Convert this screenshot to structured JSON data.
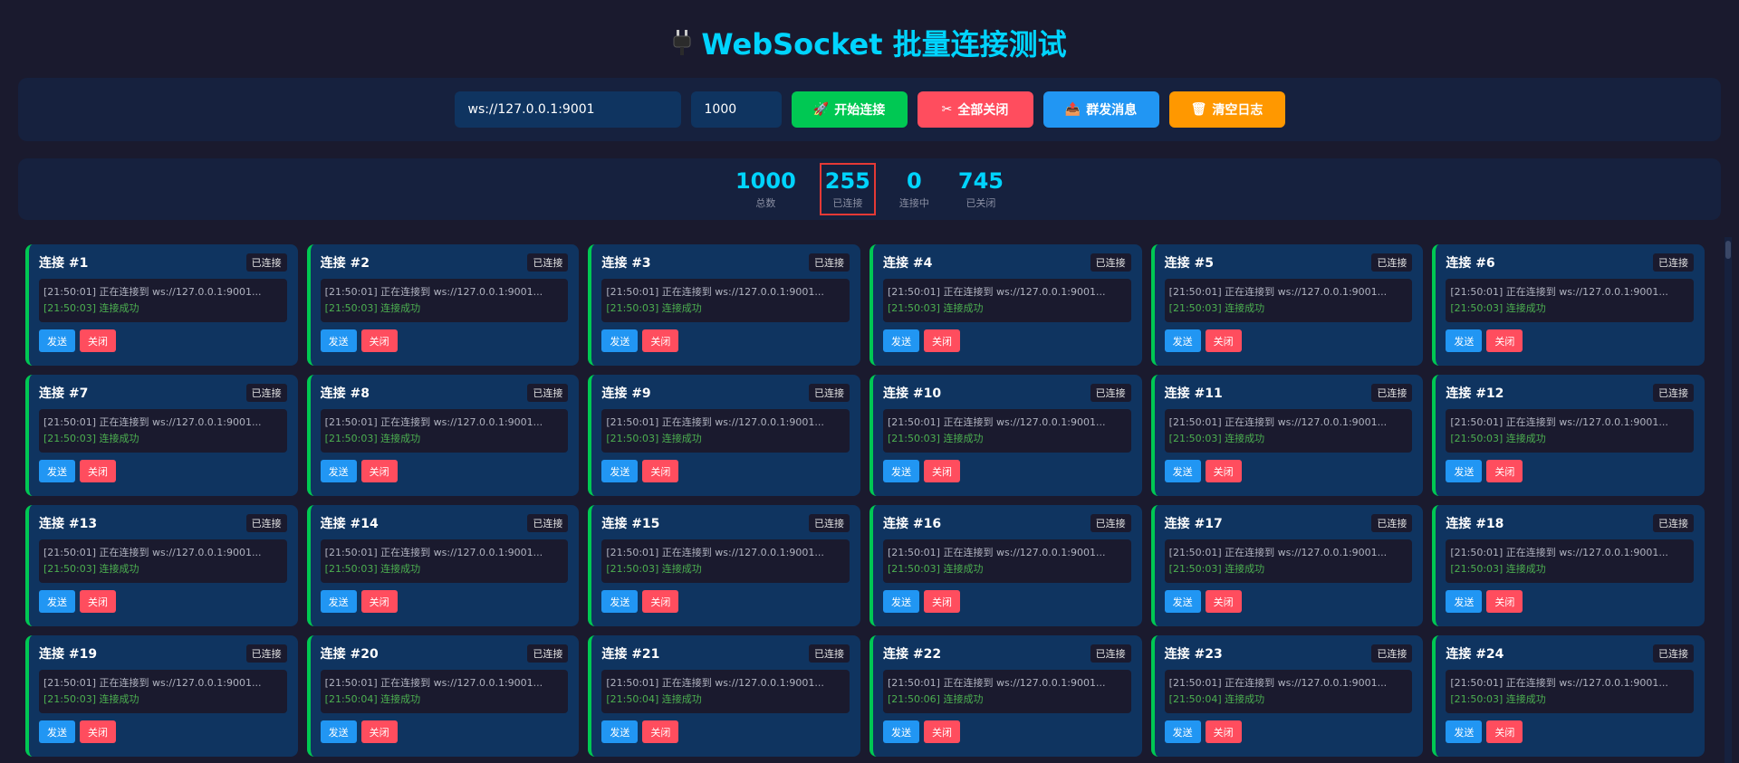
{
  "page": {
    "title": "WebSocket 批量连接测试",
    "title_icon": "plug-icon"
  },
  "controls": {
    "url_value": "ws://127.0.0.1:9001",
    "count_value": "1000",
    "start_label": "开始连接",
    "start_icon": "🚀",
    "close_all_label": "全部关闭",
    "close_all_icon": "✂",
    "broadcast_label": "群发消息",
    "broadcast_icon": "📤",
    "clear_log_label": "清空日志",
    "clear_log_icon": "🗑"
  },
  "stats": [
    {
      "value": "1000",
      "label": "总数"
    },
    {
      "value": "255",
      "label": "已连接"
    },
    {
      "value": "0",
      "label": "连接中"
    },
    {
      "value": "745",
      "label": "已关闭"
    }
  ],
  "card_labels": {
    "status": "已连接",
    "send": "发送",
    "close": "关闭"
  },
  "connections": [
    {
      "title": "连接 #1",
      "log1": "[21:50:01] 正在连接到 ws://127.0.0.1:9001...",
      "log2": "[21:50:03] 连接成功"
    },
    {
      "title": "连接 #2",
      "log1": "[21:50:01] 正在连接到 ws://127.0.0.1:9001...",
      "log2": "[21:50:03] 连接成功"
    },
    {
      "title": "连接 #3",
      "log1": "[21:50:01] 正在连接到 ws://127.0.0.1:9001...",
      "log2": "[21:50:03] 连接成功"
    },
    {
      "title": "连接 #4",
      "log1": "[21:50:01] 正在连接到 ws://127.0.0.1:9001...",
      "log2": "[21:50:03] 连接成功"
    },
    {
      "title": "连接 #5",
      "log1": "[21:50:01] 正在连接到 ws://127.0.0.1:9001...",
      "log2": "[21:50:03] 连接成功"
    },
    {
      "title": "连接 #6",
      "log1": "[21:50:01] 正在连接到 ws://127.0.0.1:9001...",
      "log2": "[21:50:03] 连接成功"
    },
    {
      "title": "连接 #7",
      "log1": "[21:50:01] 正在连接到 ws://127.0.0.1:9001...",
      "log2": "[21:50:03] 连接成功"
    },
    {
      "title": "连接 #8",
      "log1": "[21:50:01] 正在连接到 ws://127.0.0.1:9001...",
      "log2": "[21:50:03] 连接成功"
    },
    {
      "title": "连接 #9",
      "log1": "[21:50:01] 正在连接到 ws://127.0.0.1:9001...",
      "log2": "[21:50:03] 连接成功"
    },
    {
      "title": "连接 #10",
      "log1": "[21:50:01] 正在连接到 ws://127.0.0.1:9001...",
      "log2": "[21:50:03] 连接成功"
    },
    {
      "title": "连接 #11",
      "log1": "[21:50:01] 正在连接到 ws://127.0.0.1:9001...",
      "log2": "[21:50:03] 连接成功"
    },
    {
      "title": "连接 #12",
      "log1": "[21:50:01] 正在连接到 ws://127.0.0.1:9001...",
      "log2": "[21:50:03] 连接成功"
    },
    {
      "title": "连接 #13",
      "log1": "[21:50:01] 正在连接到 ws://127.0.0.1:9001...",
      "log2": "[21:50:03] 连接成功"
    },
    {
      "title": "连接 #14",
      "log1": "[21:50:01] 正在连接到 ws://127.0.0.1:9001...",
      "log2": "[21:50:03] 连接成功"
    },
    {
      "title": "连接 #15",
      "log1": "[21:50:01] 正在连接到 ws://127.0.0.1:9001...",
      "log2": "[21:50:03] 连接成功"
    },
    {
      "title": "连接 #16",
      "log1": "[21:50:01] 正在连接到 ws://127.0.0.1:9001...",
      "log2": "[21:50:03] 连接成功"
    },
    {
      "title": "连接 #17",
      "log1": "[21:50:01] 正在连接到 ws://127.0.0.1:9001...",
      "log2": "[21:50:03] 连接成功"
    },
    {
      "title": "连接 #18",
      "log1": "[21:50:01] 正在连接到 ws://127.0.0.1:9001...",
      "log2": "[21:50:03] 连接成功"
    },
    {
      "title": "连接 #19",
      "log1": "[21:50:01] 正在连接到 ws://127.0.0.1:9001...",
      "log2": "[21:50:03] 连接成功"
    },
    {
      "title": "连接 #20",
      "log1": "[21:50:01] 正在连接到 ws://127.0.0.1:9001...",
      "log2": "[21:50:04] 连接成功"
    },
    {
      "title": "连接 #21",
      "log1": "[21:50:01] 正在连接到 ws://127.0.0.1:9001...",
      "log2": "[21:50:04] 连接成功"
    },
    {
      "title": "连接 #22",
      "log1": "[21:50:01] 正在连接到 ws://127.0.0.1:9001...",
      "log2": "[21:50:06] 连接成功"
    },
    {
      "title": "连接 #23",
      "log1": "[21:50:01] 正在连接到 ws://127.0.0.1:9001...",
      "log2": "[21:50:04] 连接成功"
    },
    {
      "title": "连接 #24",
      "log1": "[21:50:01] 正在连接到 ws://127.0.0.1:9001...",
      "log2": "[21:50:03] 连接成功"
    }
  ],
  "colors": {
    "background": "#1a1a2e",
    "panel": "#16213e",
    "card": "#0f3460",
    "accent": "#00d4ff",
    "connected_border": "#00c853",
    "success_text": "#4caf50"
  }
}
